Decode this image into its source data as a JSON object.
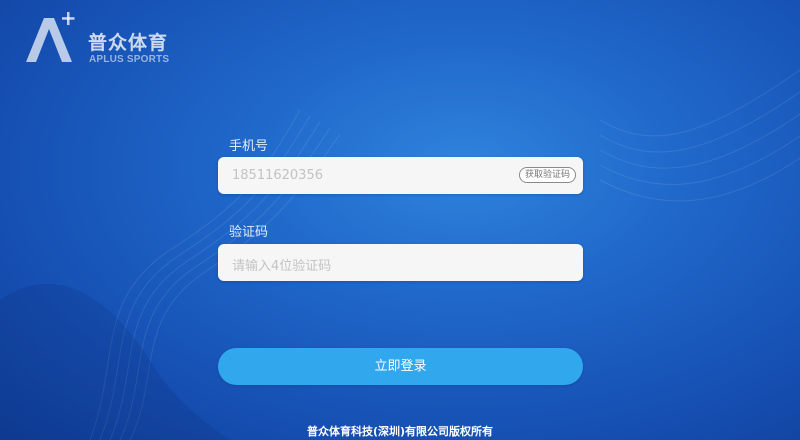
{
  "brand": {
    "cn_name": "普众体育",
    "en_name": "APLUS SPORTS",
    "logo_icon": "a-plus-logo-icon"
  },
  "form": {
    "phone": {
      "label": "手机号",
      "value": "18511620356",
      "send_code_button": "获取验证码"
    },
    "code": {
      "label": "验证码",
      "placeholder": "请输入4位验证码"
    },
    "submit_button": "立即登录"
  },
  "footer": {
    "copyright": "普众体育科技(深圳)有限公司版权所有"
  },
  "colors": {
    "background": "#1f67c9",
    "button": "#31a8ee",
    "input_bg": "#f6f6f6"
  }
}
